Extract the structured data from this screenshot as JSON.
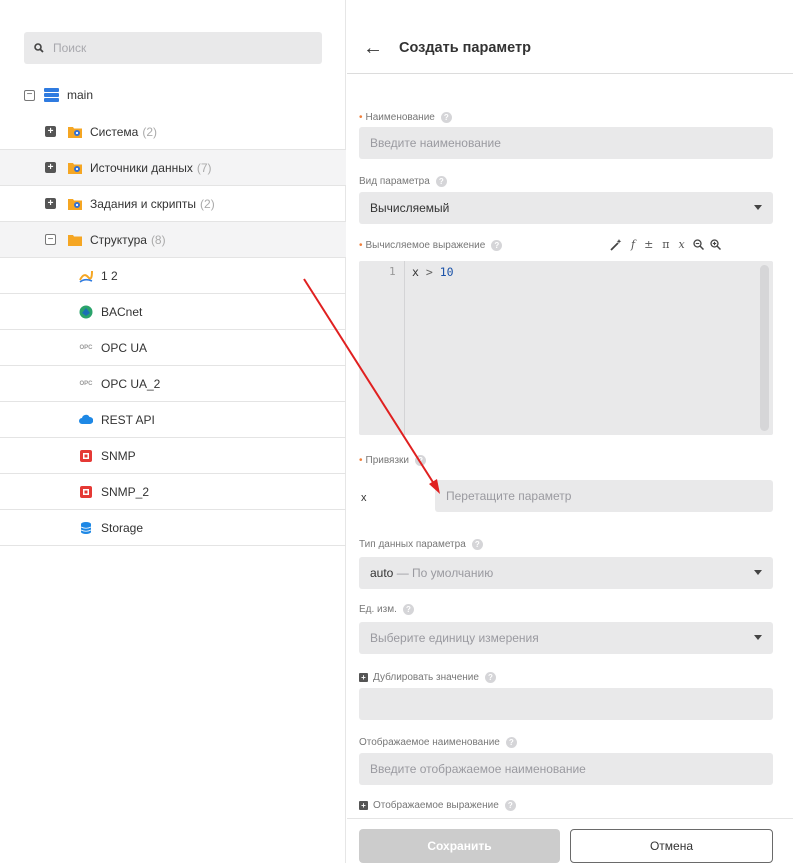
{
  "search": {
    "placeholder": "Поиск"
  },
  "tree": {
    "root_label": "main",
    "groups": [
      {
        "label": "Система",
        "count": "(2)"
      },
      {
        "label": "Источники данных",
        "count": "(7)"
      },
      {
        "label": "Задания и скрипты",
        "count": "(2)"
      },
      {
        "label": "Структура",
        "count": "(8)"
      }
    ],
    "items": [
      {
        "label": "1 2",
        "icon": "chart-icon"
      },
      {
        "label": "BACnet",
        "icon": "bacnet-icon"
      },
      {
        "label": "OPC UA",
        "icon": "opc-icon"
      },
      {
        "label": "OPC UA_2",
        "icon": "opc-icon"
      },
      {
        "label": "REST API",
        "icon": "cloud-icon"
      },
      {
        "label": "SNMP",
        "icon": "snmp-icon"
      },
      {
        "label": "SNMP_2",
        "icon": "snmp-icon"
      },
      {
        "label": "Storage",
        "icon": "database-icon"
      }
    ],
    "opc_badge": "OPC"
  },
  "form": {
    "title": "Создать параметр",
    "name_label": "Наименование",
    "name_placeholder": "Введите наименование",
    "type_label": "Вид параметра",
    "type_value": "Вычисляемый",
    "expr_label": "Вычисляемое выражение",
    "expr_line_number": "1",
    "expr_code": {
      "var": "x",
      "op": ">",
      "num": "10"
    },
    "expr_tools": [
      "f",
      "±",
      "π",
      "x"
    ],
    "bindings_label": "Привязки",
    "binding_var": "x",
    "binding_placeholder": "Перетащите параметр",
    "datatype_label": "Тип данных параметра",
    "datatype_value": "auto",
    "datatype_hint": "— По умолчанию",
    "unit_label": "Ед. изм.",
    "unit_placeholder": "Выберите единицу измерения",
    "duplicate_label": "Дублировать значение",
    "display_name_label": "Отображаемое наименование",
    "display_name_placeholder": "Введите отображаемое наименование",
    "display_expr_label": "Отображаемое выражение",
    "save_label": "Сохранить",
    "cancel_label": "Отмена"
  },
  "colors": {
    "accent_required": "#f0803c",
    "arrow": "#e02020",
    "field_bg": "#e9e9ea",
    "folder": "#f5a623"
  }
}
